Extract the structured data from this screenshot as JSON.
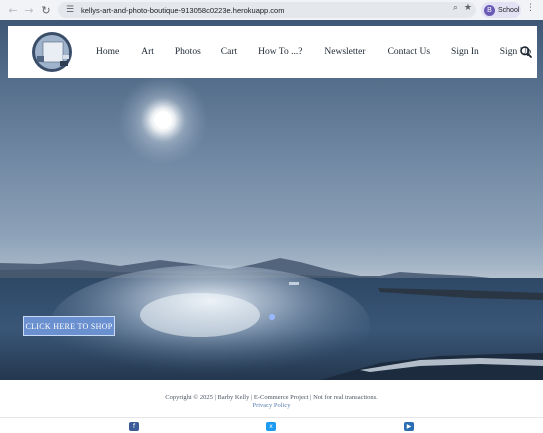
{
  "browser": {
    "url": "kellys-art-and-photo-boutique-913058c0223e.herokuapp.com",
    "profile_initial": "B",
    "profile_label": "School",
    "back_icon": "←",
    "forward_icon": "→",
    "reload_icon": "↻",
    "tune_icon": "☰",
    "zoom_icon": "⌕",
    "star_icon": "★",
    "menu_icon": "⋮"
  },
  "nav": {
    "items": [
      "Home",
      "Art",
      "Photos",
      "Cart",
      "How To ...?",
      "Newsletter",
      "Contact Us",
      "Sign In",
      "Sign Up"
    ]
  },
  "hero": {
    "cta_label": "CLICK HERE TO SHOP"
  },
  "footer": {
    "copyright": "Copyright © 2025 | Barby Kelly | E-Commerce Project | Not for real transactions.",
    "privacy": "Privacy Policy",
    "social": [
      {
        "name": "facebook-icon",
        "glyph": "f",
        "color": "#3b5b98"
      },
      {
        "name": "x-twitter-icon",
        "glyph": "x",
        "color": "#1d9bf0"
      },
      {
        "name": "youtube-icon",
        "glyph": "▶",
        "color": "#2a6fb3"
      }
    ]
  },
  "colors": {
    "cta_bg": "#6a90cf",
    "nav_text": "#1c2733",
    "footer_link": "#5b7fb0"
  }
}
